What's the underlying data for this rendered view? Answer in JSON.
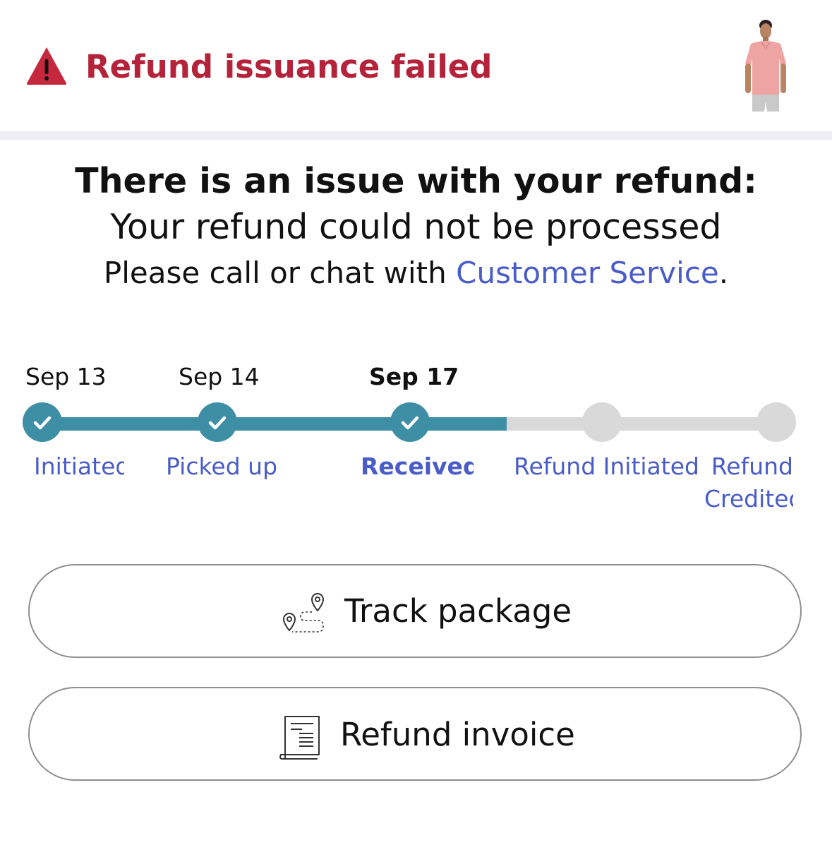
{
  "header": {
    "title": "Refund issuance failed",
    "warning_icon": "warning-triangle-icon",
    "accent_color": "#b4233a"
  },
  "message": {
    "heading": "There is an issue with your refund:",
    "line": "Your refund could not be processed",
    "help_prefix": "Please call or chat with ",
    "help_link": "Customer Service",
    "help_suffix": "."
  },
  "timeline": {
    "progress_color": "#3e8fa5",
    "pending_color": "#d9d9d9",
    "steps": [
      {
        "date": "Sep 13",
        "label": "Initiated",
        "status": "done"
      },
      {
        "date": "Sep 14",
        "label": "Picked up",
        "status": "done"
      },
      {
        "date": "Sep 17",
        "label": "Received",
        "status": "done"
      },
      {
        "date": "",
        "label": "Refund Initiated",
        "status": "pending"
      },
      {
        "date": "",
        "label": "Refund Credited",
        "status": "pending"
      }
    ]
  },
  "buttons": {
    "track_label": "Track package",
    "track_icon": "route-pin-icon",
    "invoice_label": "Refund invoice",
    "invoice_icon": "document-icon"
  },
  "link_color": "#4a5cc7"
}
